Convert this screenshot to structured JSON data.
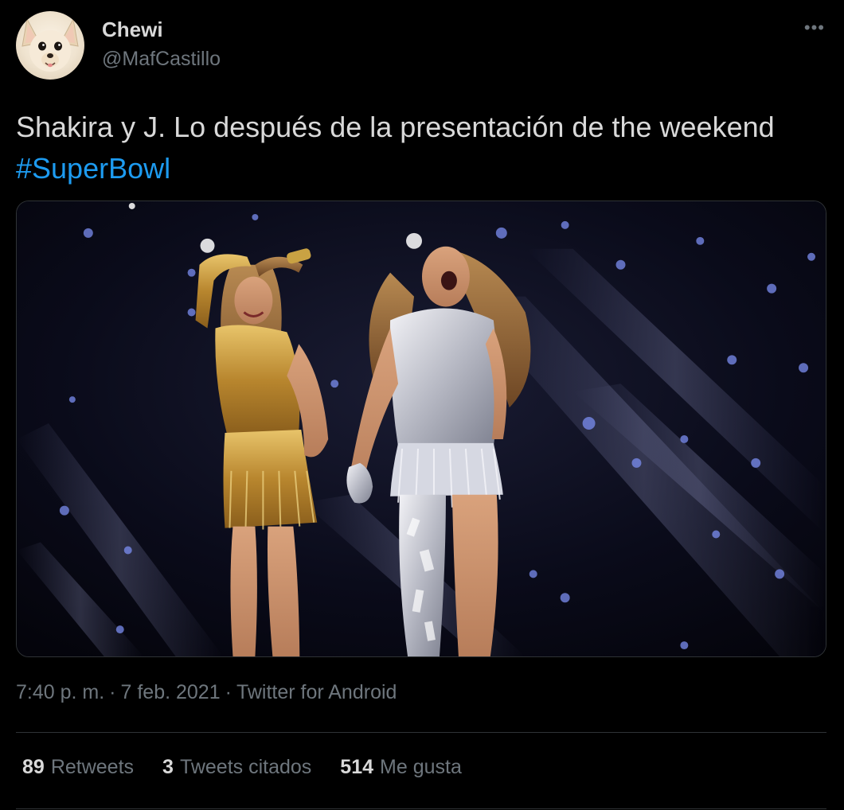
{
  "user": {
    "name": "Chewi",
    "handle": "@MafCastillo"
  },
  "menu": {
    "more_label": "•••"
  },
  "tweet": {
    "text_before": "Shakira y J. Lo después de la presentación de the weekend ",
    "hashtag": "#SuperBowl",
    "time": "7:40 p. m.",
    "separator": "·",
    "date": "7 feb. 2021",
    "source": "Twitter for Android"
  },
  "stats": {
    "retweets": {
      "count": "89",
      "label": "Retweets"
    },
    "quotes": {
      "count": "3",
      "label": "Tweets citados"
    },
    "likes": {
      "count": "514",
      "label": "Me gusta"
    }
  },
  "colors": {
    "background": "#000000",
    "text": "#d9d9d9",
    "secondary": "#6e767d",
    "link": "#1d9bf0",
    "border": "#2f3336"
  },
  "icons": {
    "avatar": "chihuahua-avatar-icon"
  }
}
